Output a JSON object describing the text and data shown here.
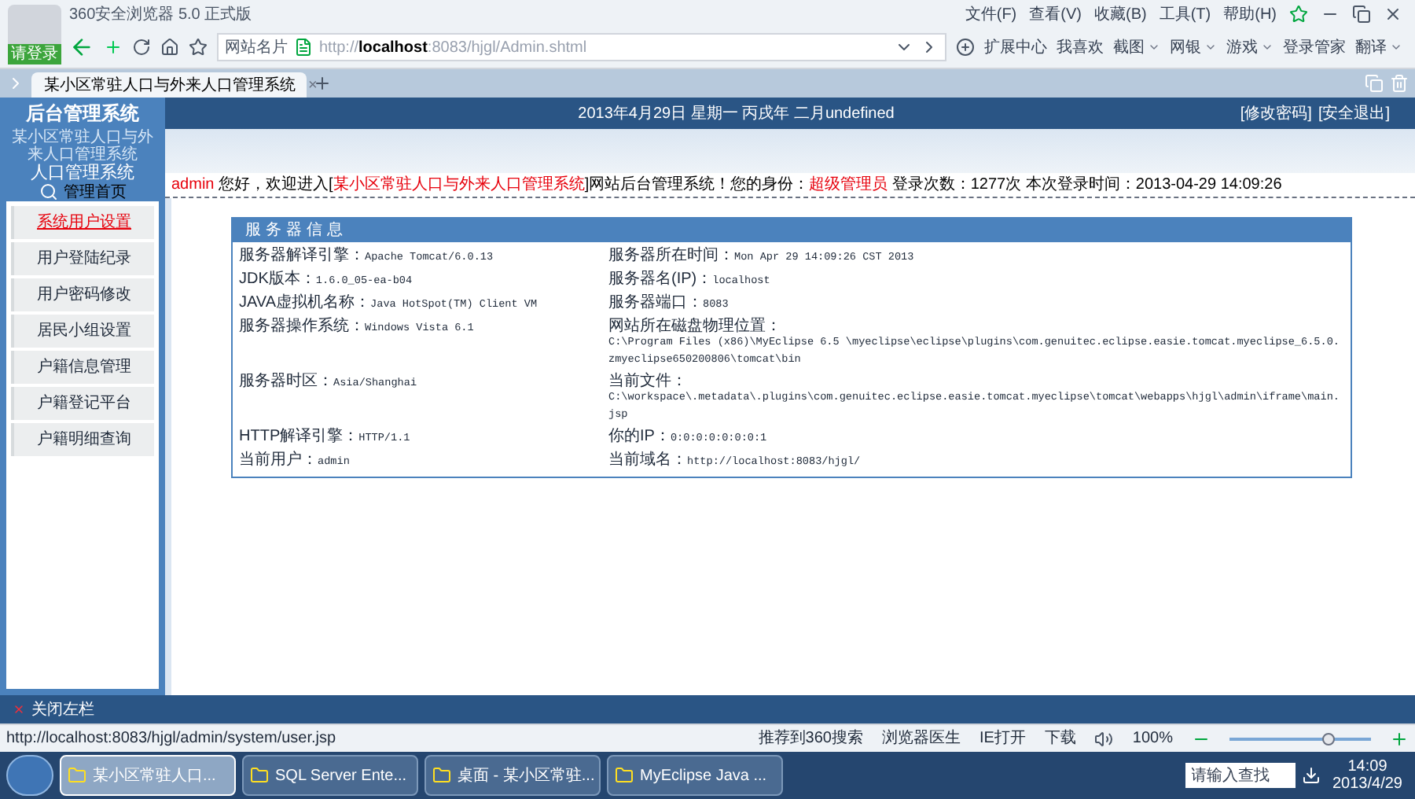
{
  "browser": {
    "title": "360安全浏览器 5.0 正式版",
    "menu": [
      "文件(F)",
      "查看(V)",
      "收藏(B)",
      "工具(T)",
      "帮助(H)"
    ],
    "login": "请登录",
    "site_card": "网站名片",
    "url_scheme": "http://",
    "url_host": "localhost",
    "url_path": ":8083/hjgl/Admin.shtml",
    "extensions": [
      {
        "label": "扩展中心",
        "dropdown": false
      },
      {
        "label": "我喜欢",
        "dropdown": false
      },
      {
        "label": "截图",
        "dropdown": true
      },
      {
        "label": "网银",
        "dropdown": true
      },
      {
        "label": "游戏",
        "dropdown": true
      },
      {
        "label": "登录管家",
        "dropdown": false
      },
      {
        "label": "翻译",
        "dropdown": true
      }
    ],
    "tabs": [
      {
        "title": "某小区常驻人口与外来人口管理系统",
        "close": "×",
        "selected": true
      }
    ]
  },
  "header": {
    "title": "后台管理系统",
    "date": "2013年4月29日 星期一 丙戌年 二月undefined",
    "links": [
      "[修改密码]",
      "[安全退出]"
    ],
    "system_name": "某小区常驻人口与外来人口管理系统",
    "subtitle": "人口管理系统",
    "home": "管理首页"
  },
  "welcome": [
    {
      "text": "admin",
      "highlight": true
    },
    {
      "text": " 您好，欢迎进入[",
      "highlight": false
    },
    {
      "text": "某小区常驻人口与外来人口管理系统",
      "highlight": true
    },
    {
      "text": "]网站后台管理系统！您的身份：",
      "highlight": false
    },
    {
      "text": "超级管理员",
      "highlight": true
    },
    {
      "text": " 登录次数：1277次 本次登录时间：2013-04-29 14:09:26",
      "highlight": false
    }
  ],
  "sidebar": {
    "items": [
      {
        "label": "系统用户设置",
        "selected": true
      },
      {
        "label": "用户登陆纪录",
        "selected": false
      },
      {
        "label": "用户密码修改",
        "selected": false
      },
      {
        "label": "居民小组设置",
        "selected": false
      },
      {
        "label": "户籍信息管理",
        "selected": false
      },
      {
        "label": "户籍登记平台",
        "selected": false
      },
      {
        "label": "户籍明细查询",
        "selected": false
      }
    ],
    "close_label": "关闭左栏"
  },
  "server_info": {
    "title": "服务器信息",
    "rows": [
      [
        {
          "label": "服务器解译引擎：",
          "value": "Apache Tomcat/6.0.13"
        },
        {
          "label": "服务器所在时间：",
          "value": "Mon Apr 29 14:09:26 CST 2013"
        }
      ],
      [
        {
          "label": "JDK版本：",
          "value": "1.6.0_05-ea-b04"
        },
        {
          "label": "服务器名(IP)：",
          "value": "localhost"
        }
      ],
      [
        {
          "label": "JAVA虚拟机名称：",
          "value": "Java HotSpot(TM) Client VM"
        },
        {
          "label": "服务器端口：",
          "value": "8083"
        }
      ],
      [
        {
          "label": "服务器操作系统：",
          "value": "Windows Vista 6.1"
        },
        {
          "label": "网站所在磁盘物理位置：",
          "value": "C:\\Program Files (x86)\\MyEclipse 6.5 \\myeclipse\\eclipse\\plugins\\com.genuitec.eclipse.easie.tomcat.myeclipse_6.5.0.zmyeclipse650200806\\tomcat\\bin"
        }
      ],
      [
        {
          "label": "服务器时区：",
          "value": "Asia/Shanghai"
        },
        {
          "label": "当前文件：",
          "value": "C:\\workspace\\.metadata\\.plugins\\com.genuitec.eclipse.easie.tomcat.myeclipse\\tomcat\\webapps\\hjgl\\admin\\iframe\\main.jsp"
        }
      ],
      [
        {
          "label": "HTTP解译引擎：",
          "value": "HTTP/1.1"
        },
        {
          "label": "你的IP：",
          "value": "0:0:0:0:0:0:0:1"
        }
      ],
      [
        {
          "label": "当前用户：",
          "value": "admin"
        },
        {
          "label": "当前域名：",
          "value": "http://localhost:8083/hjgl/"
        }
      ]
    ]
  },
  "status_bar": {
    "url": "http://localhost:8083/hjgl/admin/system/user.jsp",
    "items": [
      "推荐到360搜索",
      "浏览器医生",
      "IE打开",
      "下载"
    ],
    "zoom": "100%",
    "level": 0.7
  },
  "taskbar": {
    "items": [
      {
        "label": "某小区常驻人口...",
        "selected": true
      },
      {
        "label": "SQL Server Ente...",
        "selected": false
      },
      {
        "label": "桌面 - 某小区常驻...",
        "selected": false
      },
      {
        "label": "MyEclipse Java ...",
        "selected": false
      }
    ],
    "search_placeholder": "请输入查找",
    "time": "14:09",
    "date": "2013/4/29"
  }
}
